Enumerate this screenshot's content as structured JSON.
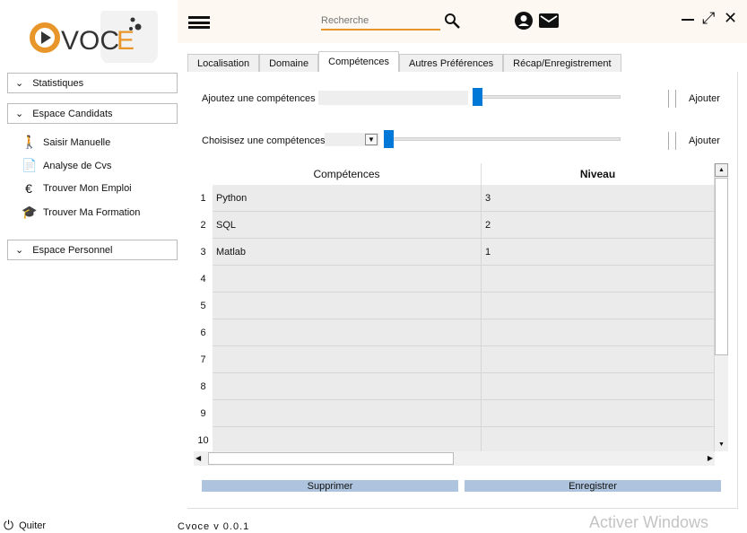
{
  "logo": {
    "text": "CVOCE"
  },
  "topbar": {
    "search_placeholder": "Recherche",
    "icons": [
      "menu-icon",
      "search-icon",
      "account-icon",
      "mail-icon",
      "minimize-icon",
      "expand-icon",
      "close-icon"
    ]
  },
  "sidebar": {
    "sections": [
      "Statistiques",
      "Espace Candidats",
      "Espace Personnel"
    ],
    "items": [
      {
        "label": "Saisir Manuelle",
        "icon": "walking-person-icon"
      },
      {
        "label": "Analyse de Cvs",
        "icon": "document-icon"
      },
      {
        "label": "Trouver Mon Emploi",
        "icon": "euro-icon"
      },
      {
        "label": "Trouver Ma Formation",
        "icon": "graduation-cap-icon"
      }
    ],
    "quit": "Quiter"
  },
  "tabs": [
    "Localisation",
    "Domaine",
    "Compétences",
    "Autres Préférences",
    "Récap/Enregistrement"
  ],
  "active_tab": "Compétences",
  "form": {
    "add_label": "Ajoutez une compétences",
    "add_button": "Ajouter",
    "choose_label": "Choisisez une compétences",
    "choose_button": "Ajouter"
  },
  "table": {
    "headers": [
      "Compétences",
      "Niveau"
    ],
    "rows": [
      [
        "Python",
        "3"
      ],
      [
        "SQL",
        "2"
      ],
      [
        "Matlab",
        "1"
      ],
      [
        "",
        ""
      ],
      [
        "",
        ""
      ],
      [
        "",
        ""
      ],
      [
        "",
        ""
      ],
      [
        "",
        ""
      ],
      [
        "",
        ""
      ],
      [
        "",
        ""
      ]
    ],
    "row_numbers": [
      "1",
      "2",
      "3",
      "4",
      "5",
      "6",
      "7",
      "8",
      "9",
      "10"
    ]
  },
  "actions": {
    "delete": "Supprimer",
    "save": "Enregistrer"
  },
  "footer": {
    "version": "Cvoce v 0.0.1",
    "watermark": "Activer Windows"
  },
  "colors": {
    "accent": "#0078d7",
    "logo_orange": "#e8962a",
    "button": "#aec4de"
  }
}
